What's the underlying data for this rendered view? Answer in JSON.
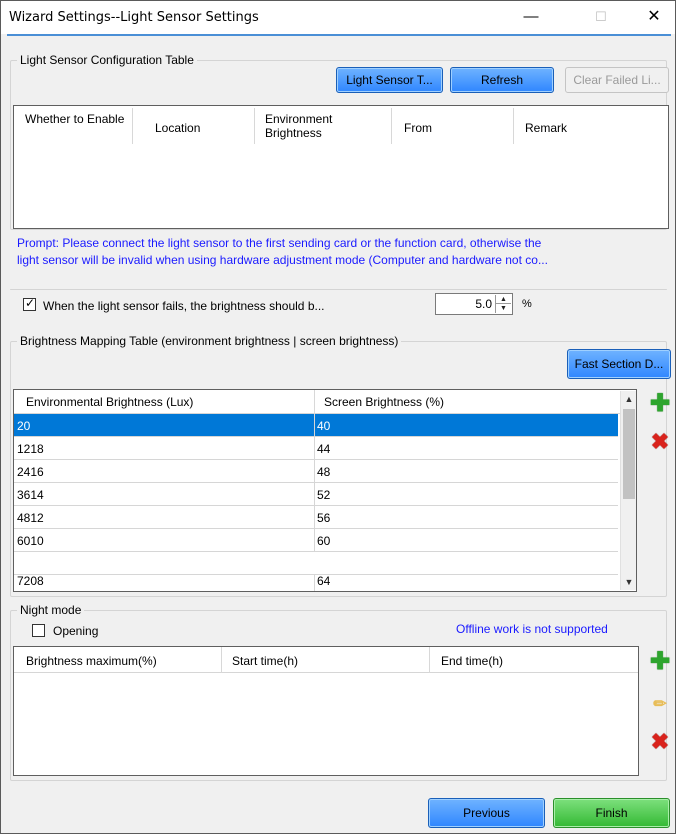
{
  "window": {
    "title": "Wizard Settings--Light Sensor Settings",
    "minimize_glyph": "—",
    "maximize_glyph": "☐",
    "close_glyph": "✕"
  },
  "sensor_config": {
    "group_label": "Light Sensor Configuration Table",
    "buttons": {
      "light_sensor": "Light Sensor T...",
      "refresh": "Refresh",
      "clear_failed": "Clear Failed Li..."
    },
    "columns": [
      "Whether to Enable",
      "Location",
      "Environment Brightness",
      "From",
      "Remark"
    ]
  },
  "prompt": {
    "line1": "Prompt: Please connect the light sensor to the first sending card or the function card, otherwise the",
    "line2": "light sensor will be invalid when using hardware adjustment mode (Computer and hardware not co..."
  },
  "fail_option": {
    "checked": true,
    "label": "When the light sensor fails, the brightness should b...",
    "value": "5.0",
    "unit": "%"
  },
  "mapping": {
    "group_label": "Brightness Mapping Table (environment brightness | screen brightness)",
    "fast_section_button": "Fast Section D...",
    "columns": [
      "Environmental Brightness (Lux)",
      "Screen Brightness (%)"
    ],
    "rows": [
      {
        "env": "20",
        "screen": "40",
        "selected": true
      },
      {
        "env": "1218",
        "screen": "44"
      },
      {
        "env": "2416",
        "screen": "48"
      },
      {
        "env": "3614",
        "screen": "52"
      },
      {
        "env": "4812",
        "screen": "56"
      },
      {
        "env": "6010",
        "screen": "60"
      },
      {
        "env": "7208",
        "screen": "64"
      }
    ]
  },
  "night_mode": {
    "group_label": "Night mode",
    "opening_label": "Opening",
    "opening_checked": false,
    "offline_note": "Offline work is not supported",
    "columns": [
      "Brightness maximum(%)",
      "Start time(h)",
      "End time(h)"
    ]
  },
  "footer": {
    "previous": "Previous",
    "finish": "Finish"
  },
  "icons": {
    "add": "plus-icon",
    "delete": "delete-icon",
    "edit": "pencil-icon"
  }
}
